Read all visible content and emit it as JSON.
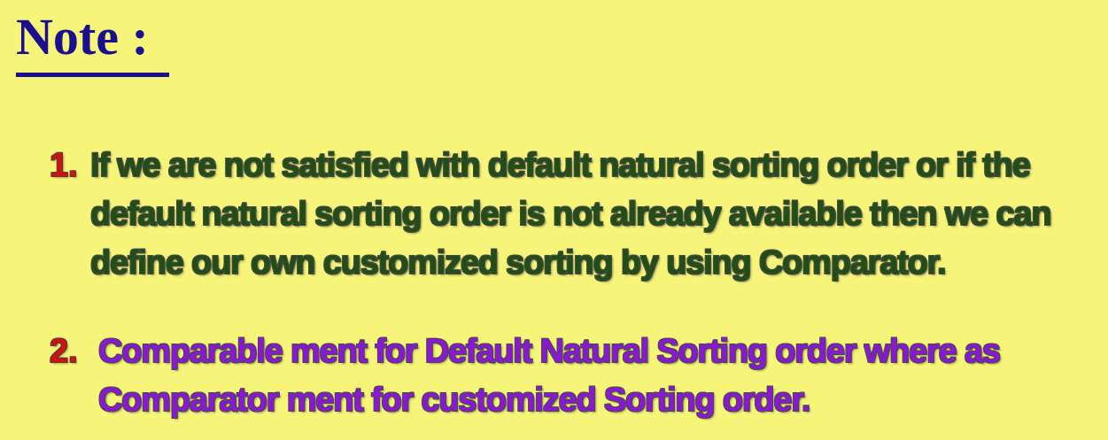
{
  "slide": {
    "title": "Note :",
    "colors": {
      "background": "#f6f57a",
      "title": "#1a0f8c",
      "number": "#d11010",
      "item1_text": "#214e14",
      "item2_text": "#8a16d6"
    },
    "items": [
      {
        "number": "1.",
        "lines": [
          "If we are not satisfied with default natural sorting order or if the",
          "default natural sorting order is not already available then we can",
          "define our own customized sorting by using Comparator."
        ]
      },
      {
        "number": "2.",
        "lines": [
          "Comparable ment for Default Natural Sorting order where as",
          "Comparator ment for customized Sorting order."
        ]
      }
    ]
  }
}
